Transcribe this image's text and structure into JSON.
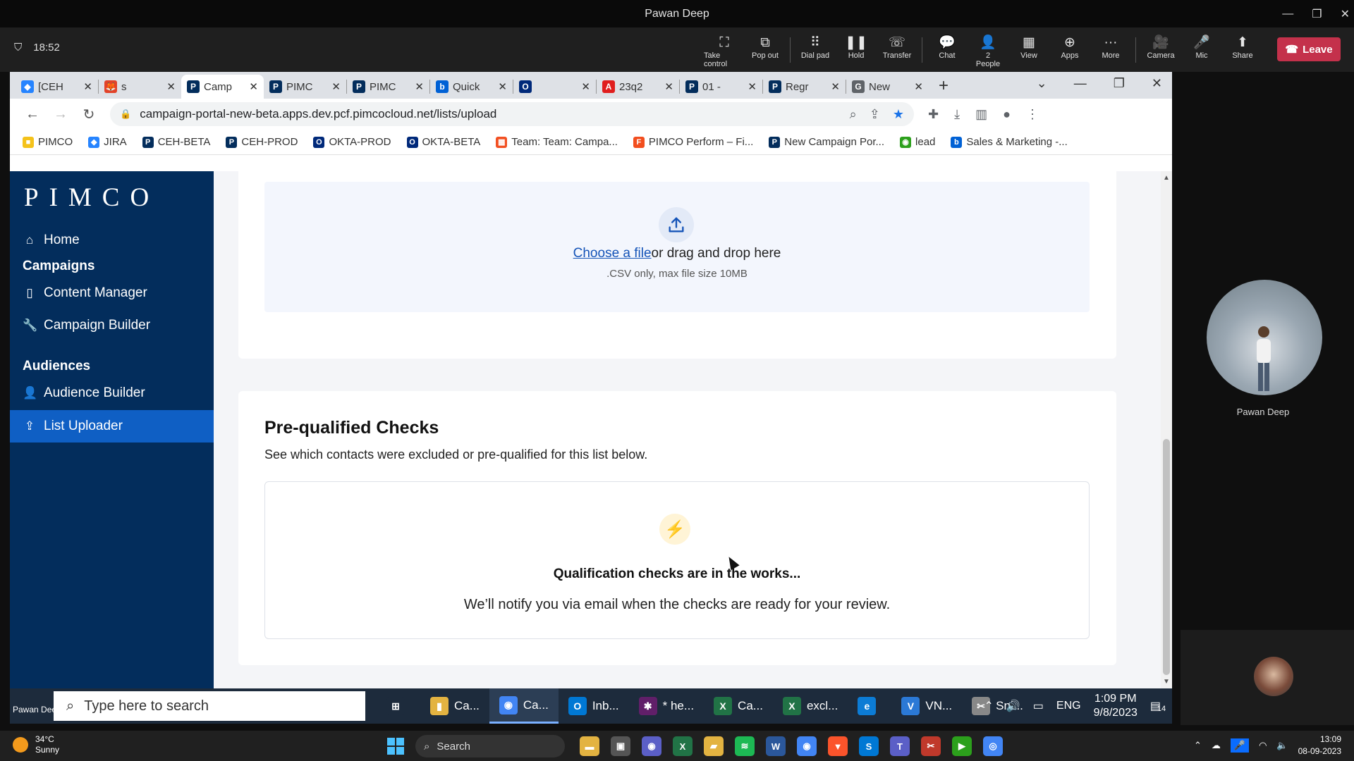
{
  "teams": {
    "window_title": "Pawan Deep",
    "timer": "18:52",
    "tools": [
      {
        "label": "Take control",
        "icon": "take-control-icon",
        "glyph": "⛶"
      },
      {
        "label": "Pop out",
        "icon": "pop-out-icon",
        "glyph": "⧉"
      },
      {
        "label": "Dial pad",
        "icon": "dial-pad-icon",
        "glyph": "⠿"
      },
      {
        "label": "Hold",
        "icon": "hold-icon",
        "glyph": "❚❚"
      },
      {
        "label": "Transfer",
        "icon": "transfer-icon",
        "glyph": "☏"
      },
      {
        "label": "Chat",
        "icon": "chat-icon",
        "glyph": "💬"
      },
      {
        "label": "People",
        "icon": "people-icon",
        "glyph": "👤",
        "badge": "2"
      },
      {
        "label": "View",
        "icon": "view-icon",
        "glyph": "▦"
      },
      {
        "label": "Apps",
        "icon": "apps-icon",
        "glyph": "⊕"
      },
      {
        "label": "More",
        "icon": "more-icon",
        "glyph": "···"
      },
      {
        "label": "Camera",
        "icon": "camera-off-icon",
        "glyph": "🎥"
      },
      {
        "label": "Mic",
        "icon": "mic-icon",
        "glyph": "🎤"
      },
      {
        "label": "Share",
        "icon": "share-icon",
        "glyph": "⬆"
      }
    ],
    "leave_label": "Leave",
    "participant_name": "Pawan Deep",
    "self_label": "Pawan Deep"
  },
  "browser": {
    "tabs": [
      {
        "label": "[CEH",
        "color": "#2684ff",
        "glyph": "◆"
      },
      {
        "label": "s",
        "color": "#e24329",
        "glyph": "🦊"
      },
      {
        "label": "Camp",
        "color": "#032d5c",
        "glyph": "P",
        "active": true
      },
      {
        "label": "PIMC",
        "color": "#032d5c",
        "glyph": "P"
      },
      {
        "label": "PIMC",
        "color": "#032d5c",
        "glyph": "P"
      },
      {
        "label": "Quick",
        "color": "#0061d5",
        "glyph": "b"
      },
      {
        "label": "",
        "color": "#00297a",
        "glyph": "O"
      },
      {
        "label": "23q2",
        "color": "#e01e1e",
        "glyph": "A"
      },
      {
        "label": "01 -",
        "color": "#032d5c",
        "glyph": "P"
      },
      {
        "label": "Regr",
        "color": "#032d5c",
        "glyph": "P"
      },
      {
        "label": "New",
        "color": "#5f6368",
        "glyph": "G"
      }
    ],
    "url": "campaign-portal-new-beta.apps.dev.pcf.pimcocloud.net/lists/upload",
    "bookmarks": [
      {
        "label": "PIMCO",
        "color": "#f4c21b",
        "glyph": "■"
      },
      {
        "label": "JIRA",
        "color": "#2684ff",
        "glyph": "◆"
      },
      {
        "label": "CEH-BETA",
        "color": "#032d5c",
        "glyph": "P"
      },
      {
        "label": "CEH-PROD",
        "color": "#032d5c",
        "glyph": "P"
      },
      {
        "label": "OKTA-PROD",
        "color": "#00297a",
        "glyph": "O"
      },
      {
        "label": "OKTA-BETA",
        "color": "#00297a",
        "glyph": "O"
      },
      {
        "label": "Team: Team: Campa...",
        "color": "#f25022",
        "glyph": "▦"
      },
      {
        "label": "PIMCO Perform – Fi...",
        "color": "#f24e1e",
        "glyph": "F"
      },
      {
        "label": "New Campaign Por...",
        "color": "#032d5c",
        "glyph": "P"
      },
      {
        "label": "lead",
        "color": "#2ca01c",
        "glyph": "◉"
      },
      {
        "label": "Sales & Marketing -...",
        "color": "#0061d5",
        "glyph": "b"
      }
    ]
  },
  "app": {
    "logo": "PIMCO",
    "nav": {
      "home": "Home",
      "campaigns_heading": "Campaigns",
      "content_manager": "Content Manager",
      "campaign_builder": "Campaign Builder",
      "audiences_heading": "Audiences",
      "audience_builder": "Audience Builder",
      "list_uploader": "List Uploader"
    },
    "upload": {
      "choose_link": "Choose a file",
      "drag_text": "or drag and drop here",
      "note": ".CSV only, max file size 10MB"
    },
    "checks": {
      "title": "Pre-qualified Checks",
      "subtitle": "See which contacts were excluded or pre-qualified for this list below.",
      "status_title": "Qualification checks are in the works...",
      "status_text": "We’ll notify you via email when the checks are ready for your review."
    }
  },
  "inner_taskbar": {
    "search_placeholder": "Type here to search",
    "apps": [
      {
        "label": "",
        "color": "#1d2b3c",
        "glyph": "⊞"
      },
      {
        "label": "Ca...",
        "color": "#e3b341",
        "glyph": "▮"
      },
      {
        "label": "Ca...",
        "color": "#4285f4",
        "glyph": "◉",
        "active": true
      },
      {
        "label": "Inb...",
        "color": "#0078d4",
        "glyph": "O"
      },
      {
        "label": "* he...",
        "color": "#611f69",
        "glyph": "✱"
      },
      {
        "label": "Ca...",
        "color": "#217346",
        "glyph": "X"
      },
      {
        "label": "excl...",
        "color": "#217346",
        "glyph": "X"
      },
      {
        "label": "",
        "color": "#0c7cd5",
        "glyph": "e"
      },
      {
        "label": "VN...",
        "color": "#2b79d6",
        "glyph": "V"
      },
      {
        "label": "Sni...",
        "color": "#888888",
        "glyph": "✂"
      }
    ],
    "lang": "ENG",
    "time": "1:09 PM",
    "date": "9/8/2023",
    "notifications": "14"
  },
  "outer_taskbar": {
    "temperature": "34°C",
    "weather": "Sunny",
    "search_label": "Search",
    "apps": [
      {
        "name": "file-explorer",
        "color": "#e3b341",
        "glyph": "▬"
      },
      {
        "name": "task-view",
        "color": "#555555",
        "glyph": "▣"
      },
      {
        "name": "teams-chat",
        "color": "#5b5fc7",
        "glyph": "◉"
      },
      {
        "name": "excel",
        "color": "#217346",
        "glyph": "X"
      },
      {
        "name": "folder",
        "color": "#e3b341",
        "glyph": "▰"
      },
      {
        "name": "spotify",
        "color": "#1db954",
        "glyph": "≋"
      },
      {
        "name": "word",
        "color": "#2b579a",
        "glyph": "W"
      },
      {
        "name": "chrome",
        "color": "#4285f4",
        "glyph": "◉"
      },
      {
        "name": "brave",
        "color": "#fb542b",
        "glyph": "▼"
      },
      {
        "name": "skype",
        "color": "#0078d4",
        "glyph": "S"
      },
      {
        "name": "teams",
        "color": "#5b5fc7",
        "glyph": "T"
      },
      {
        "name": "snip",
        "color": "#c0392b",
        "glyph": "✂"
      },
      {
        "name": "player",
        "color": "#2ca01c",
        "glyph": "▶"
      },
      {
        "name": "chrome-alt",
        "color": "#4285f4",
        "glyph": "◎"
      }
    ],
    "time": "13:09",
    "date": "08-09-2023"
  }
}
